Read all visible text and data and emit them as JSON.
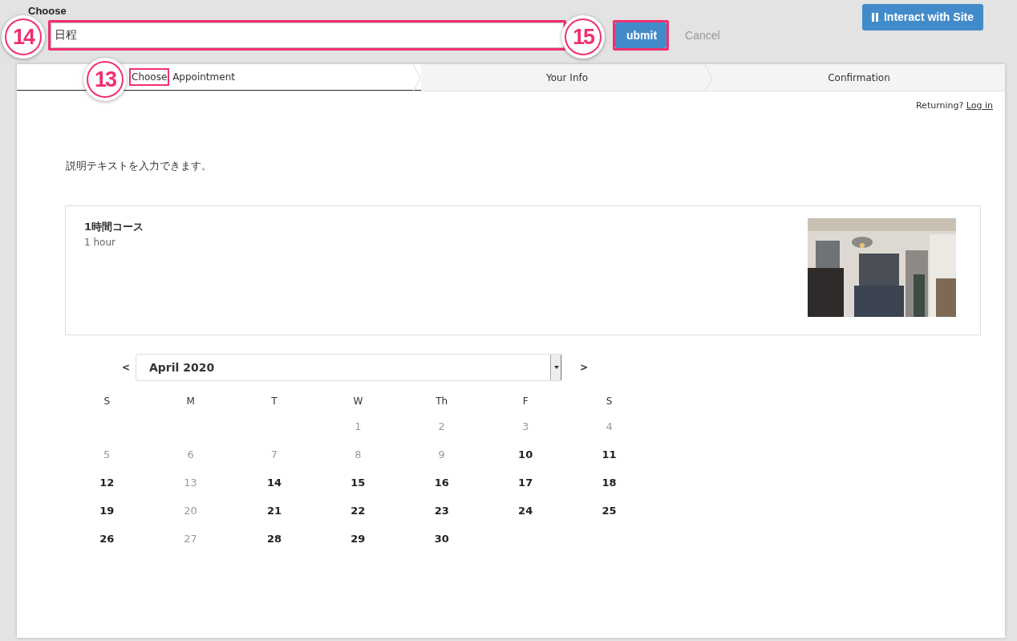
{
  "editor": {
    "label": "Choose",
    "value": "日程",
    "submit": "ubmit",
    "cancel": "Cancel",
    "interact_button": "Interact with Site"
  },
  "annotations": [
    {
      "number": "14"
    },
    {
      "number": "15"
    },
    {
      "number": "13"
    }
  ],
  "steps": [
    {
      "label_highlighted": "Choose",
      "label_rest": " Appointment",
      "selected": true
    },
    {
      "label": "Your Info",
      "selected": false
    },
    {
      "label": "Confirmation",
      "selected": false
    }
  ],
  "returning": {
    "text": "Returning?",
    "link": "Log in"
  },
  "description": "説明テキストを入力できます。",
  "service": {
    "title": "1時間コース",
    "duration": "1 hour"
  },
  "calendar": {
    "prev": "<",
    "next": ">",
    "month": "April 2020",
    "weekdays": [
      "S",
      "M",
      "T",
      "W",
      "Th",
      "F",
      "S"
    ],
    "weeks": [
      [
        {
          "empty": true
        },
        {
          "empty": true
        },
        {
          "empty": true
        },
        {
          "day": "1",
          "available": false
        },
        {
          "day": "2",
          "available": false
        },
        {
          "day": "3",
          "available": false
        },
        {
          "day": "4",
          "available": false
        }
      ],
      [
        {
          "day": "5",
          "available": false
        },
        {
          "day": "6",
          "available": false
        },
        {
          "day": "7",
          "available": false
        },
        {
          "day": "8",
          "available": false
        },
        {
          "day": "9",
          "available": false
        },
        {
          "day": "10",
          "available": true
        },
        {
          "day": "11",
          "available": true
        }
      ],
      [
        {
          "day": "12",
          "available": true
        },
        {
          "day": "13",
          "available": false
        },
        {
          "day": "14",
          "available": true
        },
        {
          "day": "15",
          "available": true
        },
        {
          "day": "16",
          "available": true
        },
        {
          "day": "17",
          "available": true
        },
        {
          "day": "18",
          "available": true
        }
      ],
      [
        {
          "day": "19",
          "available": true
        },
        {
          "day": "20",
          "available": false
        },
        {
          "day": "21",
          "available": true
        },
        {
          "day": "22",
          "available": true
        },
        {
          "day": "23",
          "available": true
        },
        {
          "day": "24",
          "available": true
        },
        {
          "day": "25",
          "available": true
        }
      ],
      [
        {
          "day": "26",
          "available": true
        },
        {
          "day": "27",
          "available": false
        },
        {
          "day": "28",
          "available": true
        },
        {
          "day": "29",
          "available": true
        },
        {
          "day": "30",
          "available": true
        },
        {
          "empty": true
        },
        {
          "empty": true
        }
      ]
    ]
  }
}
